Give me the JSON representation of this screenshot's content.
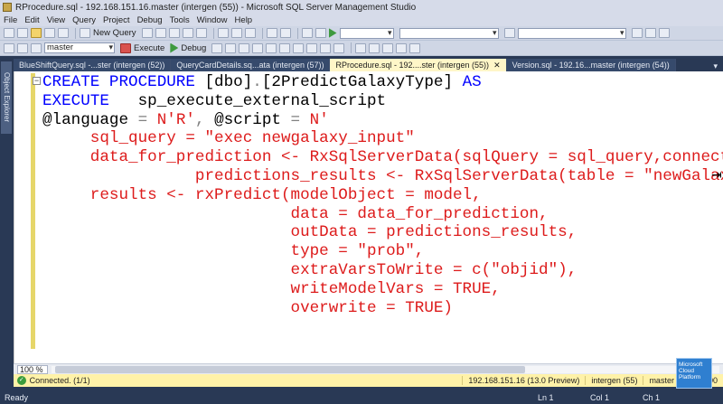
{
  "window": {
    "title": "RProcedure.sql - 192.168.151.16.master (intergen (55)) - Microsoft SQL Server Management Studio"
  },
  "menu": [
    "File",
    "Edit",
    "View",
    "Query",
    "Project",
    "Debug",
    "Tools",
    "Window",
    "Help"
  ],
  "toolbar": {
    "new_query": "New Query",
    "database": "master",
    "execute": "Execute",
    "debug": "Debug"
  },
  "left_panel": {
    "object_explorer": "Object Explorer"
  },
  "tabs": [
    {
      "label": "BlueShiftQuery.sql -...ster (intergen (52))",
      "active": false
    },
    {
      "label": "QueryCardDetails.sq...ata (intergen (57))",
      "active": false
    },
    {
      "label": "RProcedure.sql - 192....ster (intergen (55))",
      "active": true
    },
    {
      "label": "Version.sql - 192.16...master (intergen (54))",
      "active": false
    }
  ],
  "code": {
    "l1a": "CREATE PROCEDURE ",
    "l1b": "[dbo]",
    "l1c": ".",
    "l1d": "[2PredictGalaxyType] ",
    "l1e": "AS",
    "l2a": "EXECUTE   ",
    "l2b": "sp_execute_external_script",
    "l3a": "@language ",
    "l3b": "= ",
    "l3c": "N'R'",
    "l3d": ", ",
    "l3e": "@script ",
    "l3f": "= ",
    "l3g": "N'",
    "l4": "     sql_query = \"exec newgalaxy_input\"",
    "l5": "",
    "l6": "     data_for_prediction <- RxSqlServerData(sqlQuery = sql_query,connectionStr",
    "l7": "                predictions_results <- RxSqlServerData(table = \"newGalaxy_Pred",
    "l8": "",
    "l9": "     results <- rxPredict(modelObject = model,",
    "l10": "                          data = data_for_prediction,",
    "l11": "                          outData = predictions_results,",
    "l12": "                          type = \"prob\",",
    "l13": "                          extraVarsToWrite = c(\"objid\"),",
    "l14": "                          writeModelVars = TRUE,",
    "l15": "                          overwrite = TRUE)"
  },
  "zoom": "100 %",
  "query_status": {
    "message": "Connected. (1/1)",
    "server": "192.168.151.16 (13.0 Preview)",
    "user": "intergen (55)",
    "database": "master",
    "elapsed": "00:00:00"
  },
  "statusbar": {
    "ready": "Ready",
    "ln": "Ln 1",
    "col": "Col 1",
    "ch": "Ch 1"
  },
  "badge": {
    "line1": "Microsoft",
    "line2": "Cloud",
    "line3": "Platform"
  },
  "colors": {
    "keyword": "#0000ff",
    "string": "#dd1b1b",
    "chrome": "#293955",
    "status": "#fff2a8"
  }
}
